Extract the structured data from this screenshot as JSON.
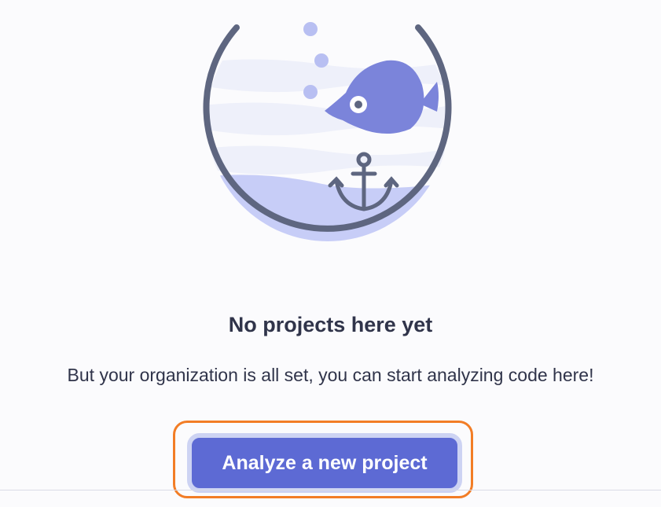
{
  "empty_state": {
    "title": "No projects here yet",
    "description": "But your organization is all set, you can start analyzing code here!",
    "illustration_icon": "fishbowl-fish-anchor-illustration"
  },
  "actions": {
    "analyze_button_label": "Analyze a new project"
  },
  "colors": {
    "accent": "#5d6ad4",
    "highlight": "#f27d26",
    "bowl_outline": "#5e6680",
    "fish": "#7b84da",
    "water": "#eef0fa",
    "sand": "#c7cdf7"
  }
}
